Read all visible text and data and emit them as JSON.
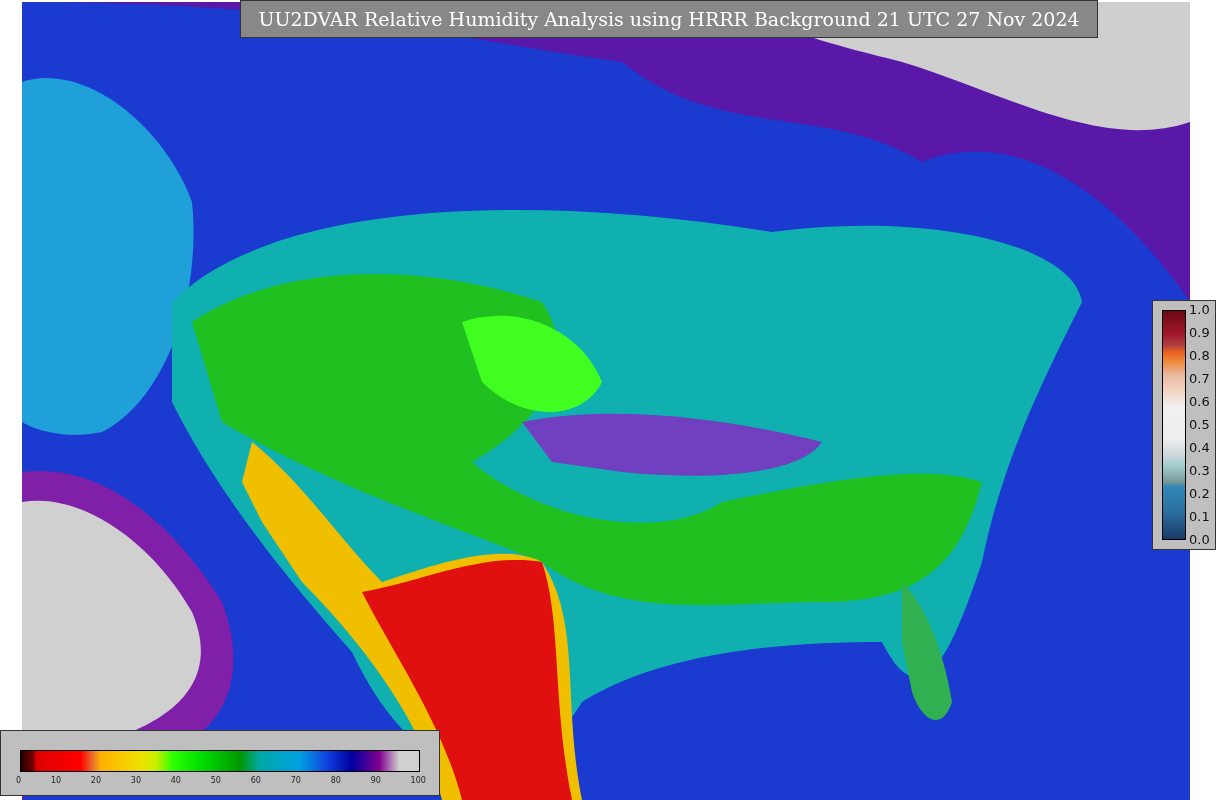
{
  "title": "UU2DVAR Relative Humidity Analysis using HRRR Background 21 UTC 27 Nov 2024",
  "humidity_colorbar": {
    "ticks": [
      "0",
      "10",
      "20",
      "30",
      "40",
      "50",
      "60",
      "70",
      "80",
      "90",
      "100"
    ]
  },
  "weight_colorbar": {
    "ticks": [
      "1.0",
      "0.9",
      "0.8",
      "0.7",
      "0.6",
      "0.5",
      "0.4",
      "0.3",
      "0.2",
      "0.1",
      "0.0"
    ]
  }
}
